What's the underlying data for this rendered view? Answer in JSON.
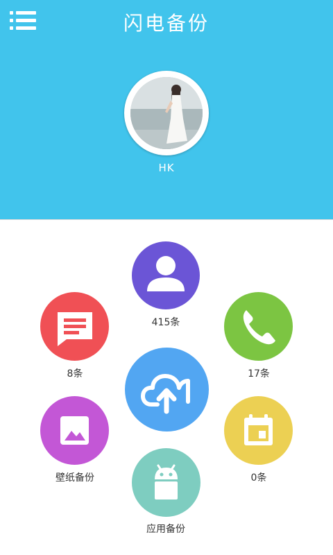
{
  "header": {
    "title": "闪电备份",
    "menu_icon": "hamburger-menu-icon",
    "username": "HK",
    "background_color": "#41c4ec"
  },
  "backup_items": {
    "contacts": {
      "label": "415条",
      "icon": "person-icon",
      "color": "#6b55d6"
    },
    "sms": {
      "label": "8条",
      "icon": "message-icon",
      "color": "#f05055"
    },
    "calls": {
      "label": "17条",
      "icon": "phone-icon",
      "color": "#7cc542"
    },
    "wallpaper": {
      "label": "壁纸备份",
      "icon": "image-icon",
      "color": "#c357d6"
    },
    "calendar": {
      "label": "0条",
      "icon": "calendar-icon",
      "color": "#ecd053"
    },
    "apps": {
      "label": "应用备份",
      "icon": "android-icon",
      "color": "#7ecdc0"
    },
    "cloud": {
      "icon": "cloud-upload-icon",
      "color": "#52a6f2"
    }
  }
}
